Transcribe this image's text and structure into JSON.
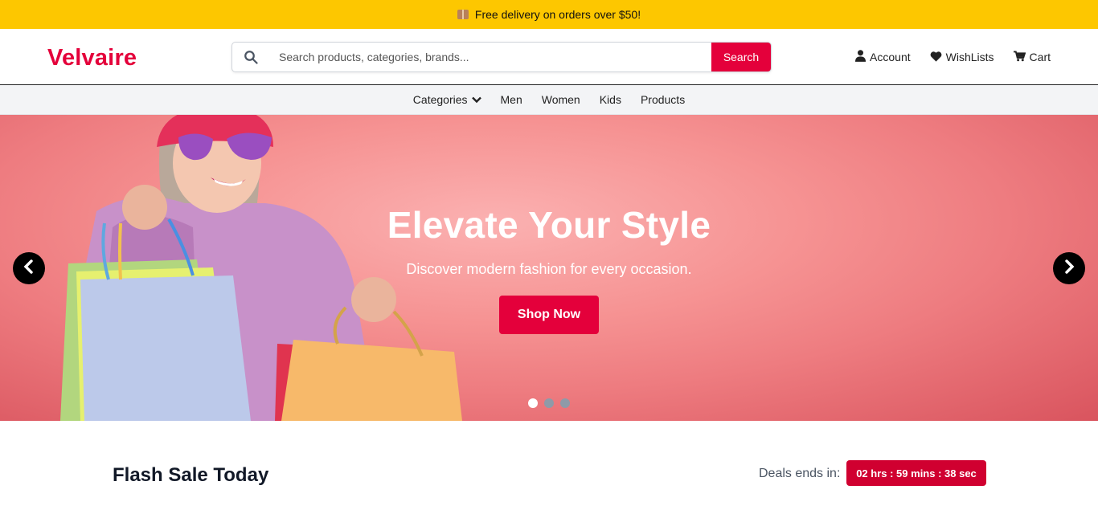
{
  "promo": {
    "text": "Free delivery on orders over $50!",
    "icon": "package-icon"
  },
  "brand": {
    "name": "Velvaire",
    "color": "#e4003b"
  },
  "search": {
    "placeholder": "Search products, categories, brands...",
    "button_label": "Search",
    "icon": "search-icon"
  },
  "header_links": [
    {
      "label": "Account",
      "icon": "user-icon"
    },
    {
      "label": "WishLists",
      "icon": "heart-icon"
    },
    {
      "label": "Cart",
      "icon": "cart-icon"
    }
  ],
  "nav": {
    "items": [
      {
        "label": "Categories",
        "icon": "chevron-down-icon"
      },
      {
        "label": "Men"
      },
      {
        "label": "Women"
      },
      {
        "label": "Kids"
      },
      {
        "label": "Products"
      }
    ]
  },
  "hero": {
    "title": "Elevate Your Style",
    "subtitle": "Discover modern fashion for every occasion.",
    "cta_label": "Shop Now",
    "slides_count": 3,
    "active_slide": 1
  },
  "flash_sale": {
    "title": "Flash Sale Today",
    "deals_label": "Deals ends in:",
    "countdown": "02 hrs : 59 mins : 38 sec"
  },
  "colors": {
    "promo_bar": "#fdc700",
    "accent": "#e4003b",
    "timer": "#d00030"
  }
}
